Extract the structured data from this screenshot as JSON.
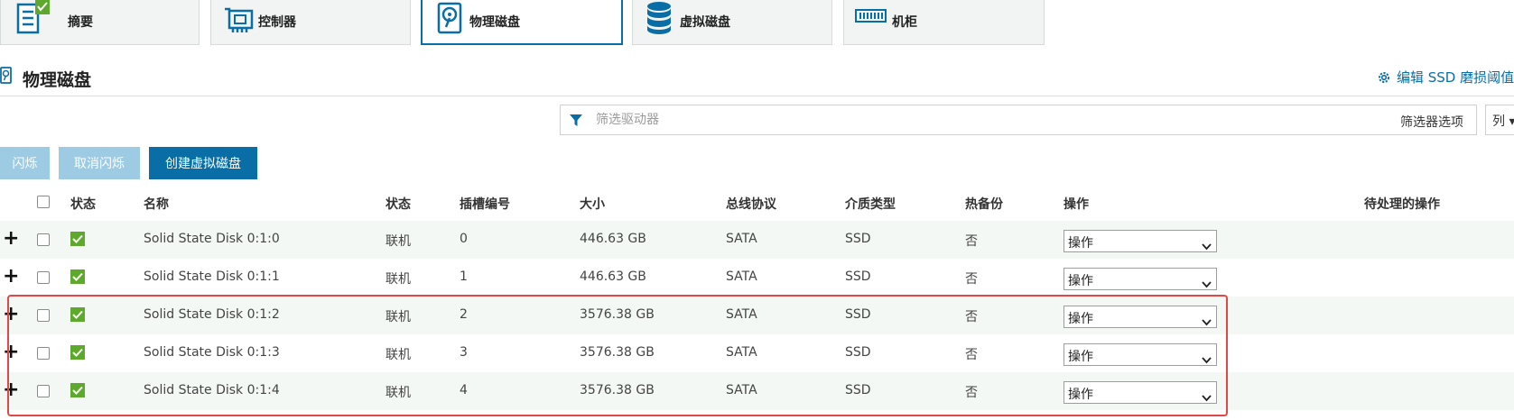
{
  "tabs": [
    {
      "label": "摘要",
      "icon": "summary-icon"
    },
    {
      "label": "控制器",
      "icon": "controller-icon"
    },
    {
      "label": "物理磁盘",
      "icon": "physical-disk-icon"
    },
    {
      "label": "虚拟磁盘",
      "icon": "database-icon"
    },
    {
      "label": "机柜",
      "icon": "enclosure-icon"
    }
  ],
  "section": {
    "title": "物理磁盘",
    "ssd_link": "编辑 SSD 磨损阈值"
  },
  "filter": {
    "placeholder": "筛选驱动器",
    "value": "",
    "options_label": "筛选器选项",
    "columns_label": "列 ▾"
  },
  "buttons": {
    "blink": "闪烁",
    "unblink": "取消闪烁",
    "create_vd": "创建虚拟磁盘"
  },
  "table": {
    "headers": {
      "status": "状态",
      "name": "名称",
      "state": "状态",
      "slot": "插槽编号",
      "size": "大小",
      "bus": "总线协议",
      "media": "介质类型",
      "hotspare": "热备份",
      "action": "操作",
      "pending": "待处理的操作"
    },
    "rows": [
      {
        "name": "Solid State Disk 0:1:0",
        "state": "联机",
        "slot": "0",
        "size": "446.63 GB",
        "bus": "SATA",
        "media": "SSD",
        "hotspare": "否",
        "action": "操作",
        "pending": ""
      },
      {
        "name": "Solid State Disk 0:1:1",
        "state": "联机",
        "slot": "1",
        "size": "446.63 GB",
        "bus": "SATA",
        "media": "SSD",
        "hotspare": "否",
        "action": "操作",
        "pending": ""
      },
      {
        "name": "Solid State Disk 0:1:2",
        "state": "联机",
        "slot": "2",
        "size": "3576.38 GB",
        "bus": "SATA",
        "media": "SSD",
        "hotspare": "否",
        "action": "操作",
        "pending": ""
      },
      {
        "name": "Solid State Disk 0:1:3",
        "state": "联机",
        "slot": "3",
        "size": "3576.38 GB",
        "bus": "SATA",
        "media": "SSD",
        "hotspare": "否",
        "action": "操作",
        "pending": ""
      },
      {
        "name": "Solid State Disk 0:1:4",
        "state": "联机",
        "slot": "4",
        "size": "3576.38 GB",
        "bus": "SATA",
        "media": "SSD",
        "hotspare": "否",
        "action": "操作",
        "pending": ""
      }
    ]
  },
  "colors": {
    "accent": "#0a6ea6",
    "ok_green": "#5ea82e",
    "highlight_red": "#e04848",
    "disabled_button": "#9ccbe3",
    "zebra_row": "#f4f8f4"
  }
}
